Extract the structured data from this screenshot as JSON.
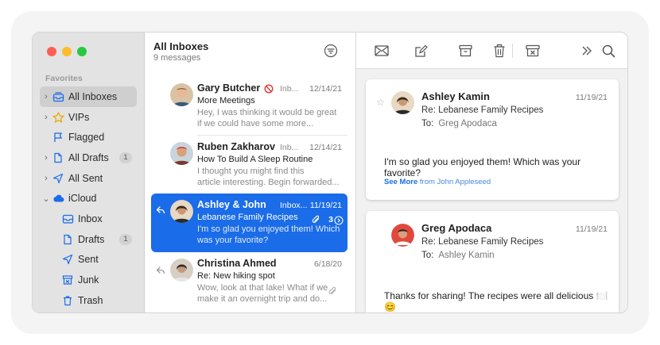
{
  "sidebar": {
    "section_header": "Favorites",
    "items": [
      {
        "label": "All Inboxes",
        "icon": "inbox-stack-icon",
        "badge": ""
      },
      {
        "label": "VIPs",
        "icon": "star-icon",
        "badge": ""
      },
      {
        "label": "Flagged",
        "icon": "flag-icon",
        "badge": ""
      },
      {
        "label": "All Drafts",
        "icon": "document-icon",
        "badge": "1"
      },
      {
        "label": "All Sent",
        "icon": "paper-plane-icon",
        "badge": ""
      },
      {
        "label": "iCloud",
        "icon": "cloud-icon",
        "badge": ""
      },
      {
        "label": "Inbox",
        "icon": "inbox-tray-icon",
        "badge": ""
      },
      {
        "label": "Drafts",
        "icon": "document-icon",
        "badge": "1"
      },
      {
        "label": "Sent",
        "icon": "paper-plane-icon",
        "badge": ""
      },
      {
        "label": "Junk",
        "icon": "junk-box-icon",
        "badge": ""
      },
      {
        "label": "Trash",
        "icon": "trash-icon",
        "badge": ""
      }
    ]
  },
  "message_list": {
    "title": "All Inboxes",
    "subtitle": "9 messages",
    "messages": [
      {
        "sender": "Gary Butcher",
        "folder": "Inb...",
        "date": "12/14/21",
        "subject": "More Meetings",
        "preview_line1": "Hey, I was thinking it would be great",
        "preview_line2": "if we could have some more..."
      },
      {
        "sender": "Ruben Zakharov",
        "folder": "Inb...",
        "date": "12/14/21",
        "subject": "How To Build A Sleep Routine",
        "preview_line1": "I thought you might find this",
        "preview_line2": "article interesting. Begin forwarded..."
      },
      {
        "sender": "Ashley & John",
        "folder": "Inbox...",
        "date": "11/19/21",
        "subject": "Lebanese Family Recipes",
        "preview_line1": "I'm so glad you enjoyed them! Which",
        "preview_line2": "was your favorite?",
        "count": "3"
      },
      {
        "sender": "Christina Ahmed",
        "folder": "",
        "date": "6/18/20",
        "subject": "Re: New hiking spot",
        "preview_line1": "Wow, look at that lake! What if we",
        "preview_line2": "make it an overnight trip and do..."
      }
    ]
  },
  "reader": {
    "toolbar": [
      "envelope-icon",
      "compose-icon",
      "archive-icon",
      "trash-icon",
      "junk-box-icon",
      "chevron-double-right-icon",
      "search-icon"
    ],
    "cards": [
      {
        "name": "Ashley Kamin",
        "date": "11/19/21",
        "subject": "Re: Lebanese Family Recipes",
        "to_label": "To:",
        "to_name": "Greg Apodaca",
        "body": "I'm so glad you enjoyed them! Which was your favorite?",
        "see_more": "See More",
        "see_more_from": "from John Appleseed"
      },
      {
        "name": "Greg Apodaca",
        "date": "11/19/21",
        "subject": "Re: Lebanese Family Recipes",
        "to_label": "To:",
        "to_name": "Ashley Kamin",
        "body": "Thanks for sharing! The recipes were all delicious 🍽️😊"
      }
    ]
  },
  "colors": {
    "accent": "#1a6ce8",
    "sidebar_bg": "#e3e3e3",
    "close": "#fe5f57",
    "minimize": "#febc2e",
    "zoom": "#28c840"
  }
}
